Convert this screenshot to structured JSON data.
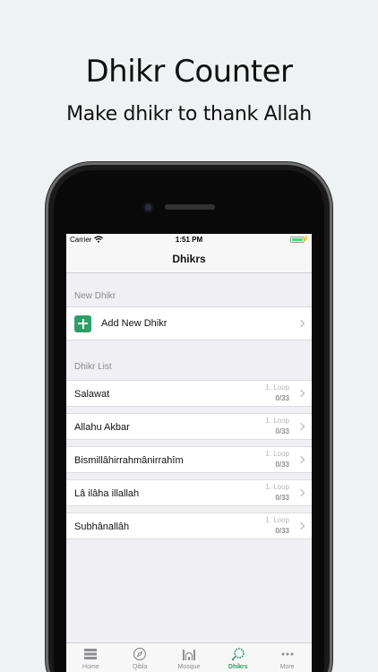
{
  "hero": {
    "title": "Dhikr Counter",
    "subtitle": "Make dhikr to thank Allah"
  },
  "status": {
    "carrier": "Carrier",
    "time": "1:51 PM"
  },
  "navbar": {
    "title": "Dhikrs"
  },
  "new_section": {
    "header": "New Dhikr",
    "add_label": "Add New Dhikr"
  },
  "list_section": {
    "header": "Dhikr List",
    "items": [
      {
        "name": "Salawat",
        "loop": "1. Loop",
        "count": "0/33"
      },
      {
        "name": "Allahu Akbar",
        "loop": "1. Loop",
        "count": "0/33"
      },
      {
        "name": "Bismillâhirrahmânirrahîm",
        "loop": "1. Loop",
        "count": "0/33"
      },
      {
        "name": "Lâ ilâha illallah",
        "loop": "1. Loop",
        "count": "0/33"
      },
      {
        "name": "Subhânallâh",
        "loop": "1. Loop",
        "count": "0/33"
      }
    ]
  },
  "tabs": [
    {
      "label": "Home",
      "icon": "home-icon"
    },
    {
      "label": "Qibla",
      "icon": "compass-icon"
    },
    {
      "label": "Mosque",
      "icon": "mosque-icon"
    },
    {
      "label": "Dhikrs",
      "icon": "prayer-beads-icon",
      "active": true
    },
    {
      "label": "More",
      "icon": "more-icon"
    }
  ],
  "colors": {
    "accent": "#2f9e6a",
    "battery": "#4cd964",
    "background": "#eff2f2"
  }
}
